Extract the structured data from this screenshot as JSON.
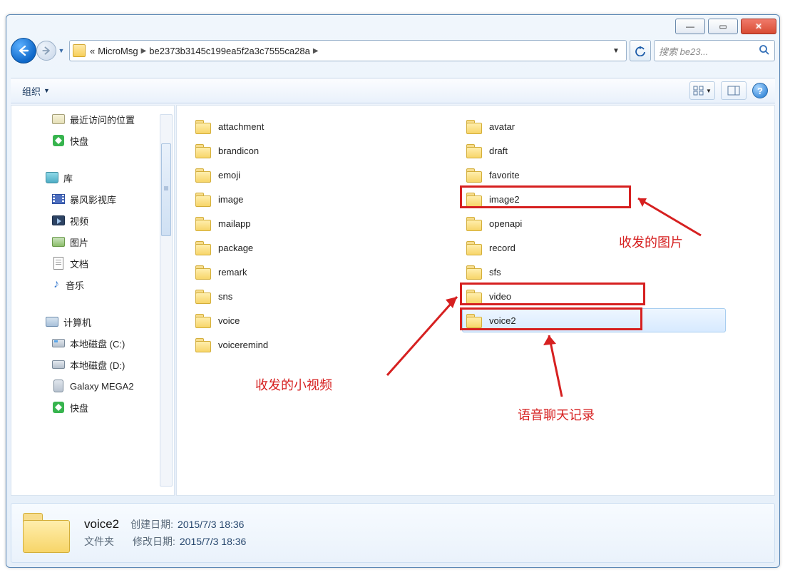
{
  "titlebar": {
    "min": "—",
    "max": "▭",
    "close": "✕"
  },
  "breadcrumb": {
    "prefix": "«",
    "items": [
      "MicroMsg",
      "be2373b3145c199ea5f2a3c7555ca28a"
    ],
    "suffix": ""
  },
  "search": {
    "placeholder": "搜索 be23..."
  },
  "toolbar": {
    "organize": "组织",
    "view_icon": "⊞",
    "preview_icon": "▯▯",
    "help": "?"
  },
  "sidebar": {
    "recent": "最近访问的位置",
    "kuaipan": "快盘",
    "library": "库",
    "baofeng": "暴风影视库",
    "videos": "视频",
    "pictures": "图片",
    "documents": "文档",
    "music": "音乐",
    "music_glyph": "♪",
    "computer": "计算机",
    "disk_c": "本地磁盘 (C:)",
    "disk_d": "本地磁盘 (D:)",
    "galaxy": "Galaxy MEGA2",
    "kuaipan2": "快盘"
  },
  "folders_col1": [
    "attachment",
    "brandicon",
    "emoji",
    "image",
    "mailapp",
    "package",
    "remark",
    "sns",
    "voice",
    "voiceremind"
  ],
  "folders_col2": [
    "avatar",
    "draft",
    "favorite",
    "image2",
    "openapi",
    "record",
    "sfs",
    "video",
    "voice2"
  ],
  "selected": "voice2",
  "annotations": {
    "images": "收发的图片",
    "video": "收发的小视频",
    "voice": "语音聊天记录"
  },
  "details": {
    "name": "voice2",
    "created_label": "创建日期:",
    "created_value": "2015/7/3 18:36",
    "type": "文件夹",
    "modified_label": "修改日期:",
    "modified_value": "2015/7/3 18:36"
  }
}
